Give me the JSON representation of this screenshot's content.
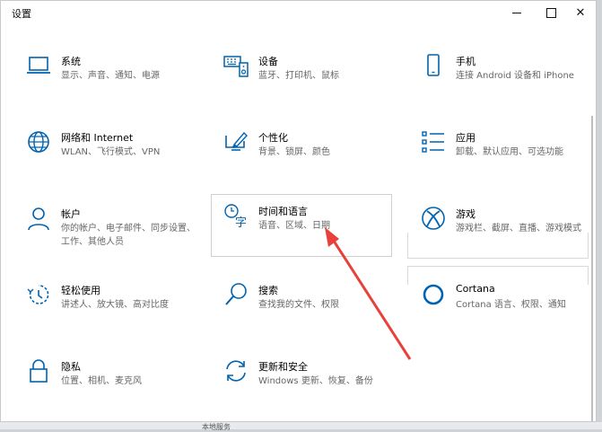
{
  "window": {
    "title": "设置"
  },
  "controls": {
    "minimize": "—",
    "maximize": "☐",
    "close": "✕"
  },
  "tiles": [
    {
      "name": "系统",
      "desc": "显示、声音、通知、电源",
      "icon": "laptop-icon"
    },
    {
      "name": "设备",
      "desc": "蓝牙、打印机、鼠标",
      "icon": "keyboard-speaker-icon"
    },
    {
      "name": "手机",
      "desc": "连接 Android 设备和 iPhone",
      "icon": "phone-icon"
    },
    {
      "name": "网络和 Internet",
      "desc": "WLAN、飞行模式、VPN",
      "icon": "globe-icon"
    },
    {
      "name": "个性化",
      "desc": "背景、锁屏、颜色",
      "icon": "paint-screen-icon"
    },
    {
      "name": "应用",
      "desc": "卸载、默认应用、可选功能",
      "icon": "apps-list-icon"
    },
    {
      "name": "帐户",
      "desc": "你的帐户、电子邮件、同步设置、工作、其他人员",
      "icon": "person-icon"
    },
    {
      "name": "时间和语言",
      "desc": "语音、区域、日期",
      "icon": "time-language-icon"
    },
    {
      "name": "游戏",
      "desc": "游戏栏、截屏、直播、游戏模式",
      "icon": "xbox-icon"
    },
    {
      "name": "轻松使用",
      "desc": "讲述人、放大镜、高对比度",
      "icon": "ease-access-icon"
    },
    {
      "name": "搜索",
      "desc": "查找我的文件、权限",
      "icon": "search-icon"
    },
    {
      "name": "Cortana",
      "desc": "Cortana 语言、权限、通知",
      "icon": "cortana-icon"
    },
    {
      "name": "隐私",
      "desc": "位置、相机、麦克风",
      "icon": "lock-icon"
    },
    {
      "name": "更新和安全",
      "desc": "Windows 更新、恢复、备份",
      "icon": "update-icon"
    }
  ],
  "taskbar": {
    "text": "本地服务"
  },
  "colors": {
    "accent": "#0063b1",
    "annotation_arrow": "#e8413c"
  }
}
